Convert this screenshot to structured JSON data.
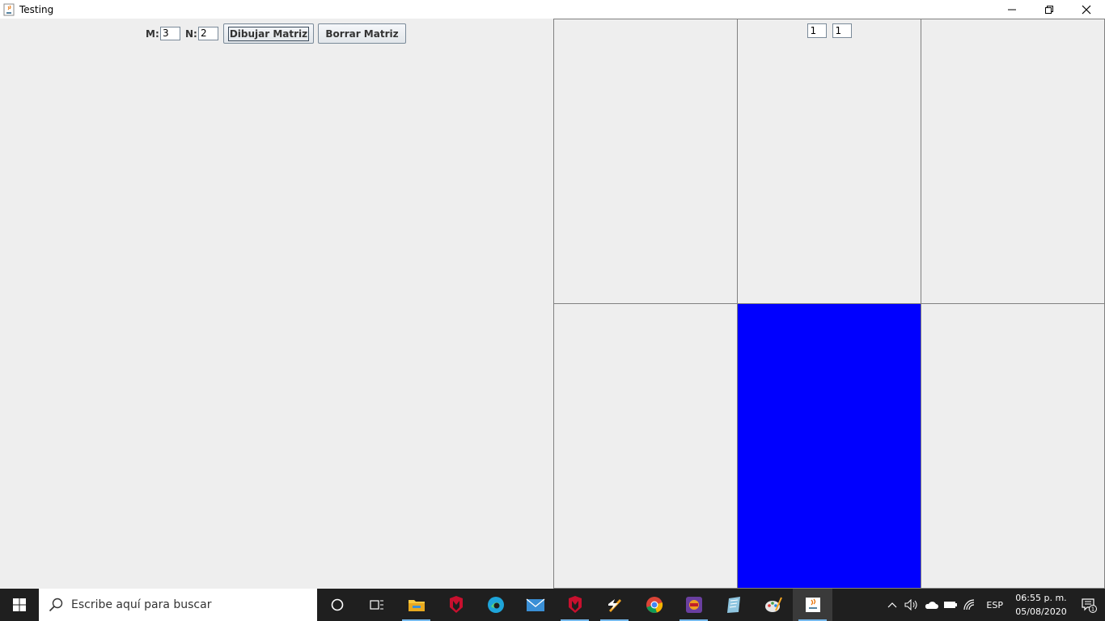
{
  "window": {
    "title": "Testing",
    "icon": "java-cup-icon"
  },
  "controls": {
    "m_label": "M:",
    "m_value": "3",
    "n_label": "N:",
    "n_value": "2",
    "draw_button": "Dibujar Matriz",
    "clear_button": "Borrar Matriz"
  },
  "matrix": {
    "rows": 2,
    "cols": 3,
    "active_cell": {
      "row": 2,
      "col": 2
    },
    "active_color": "#0000FF",
    "cell_inputs": [
      "1",
      "1"
    ]
  },
  "taskbar": {
    "search_placeholder": "Escribe aquí para buscar",
    "apps": [
      "cortana-icon",
      "task-view-icon",
      "file-explorer-icon",
      "mcafee-icon",
      "edge-icon",
      "mail-icon",
      "mcafee-icon",
      "winamp-icon",
      "chrome-icon",
      "game-icon",
      "notes-icon",
      "paint-icon",
      "java-icon"
    ],
    "language": "ESP",
    "time": "06:55 p. m.",
    "date": "05/08/2020",
    "notification_count": "1"
  }
}
